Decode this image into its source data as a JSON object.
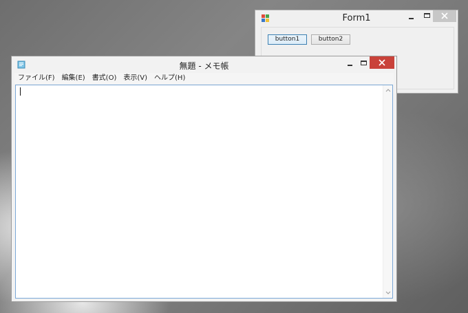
{
  "form1": {
    "title": "Form1",
    "button1_label": "button1",
    "button2_label": "button2"
  },
  "notepad": {
    "title": "無題 - メモ帳",
    "menu": [
      {
        "label": "ファイル(F)"
      },
      {
        "label": "編集(E)"
      },
      {
        "label": "書式(O)"
      },
      {
        "label": "表示(V)"
      },
      {
        "label": "ヘルプ(H)"
      }
    ],
    "text": ""
  },
  "icons": {
    "form1_app": "winforms-app-icon",
    "notepad_app": "notepad-icon",
    "minimize": "minimize-icon",
    "maximize": "maximize-icon",
    "close": "close-icon",
    "scroll_up": "scroll-up-icon",
    "scroll_down": "scroll-down-icon"
  },
  "colors": {
    "close_active": "#c9423a",
    "close_inactive": "#c7c7c7",
    "editor_border": "#7aa7d6",
    "button_focus_border": "#3c7fb1"
  }
}
